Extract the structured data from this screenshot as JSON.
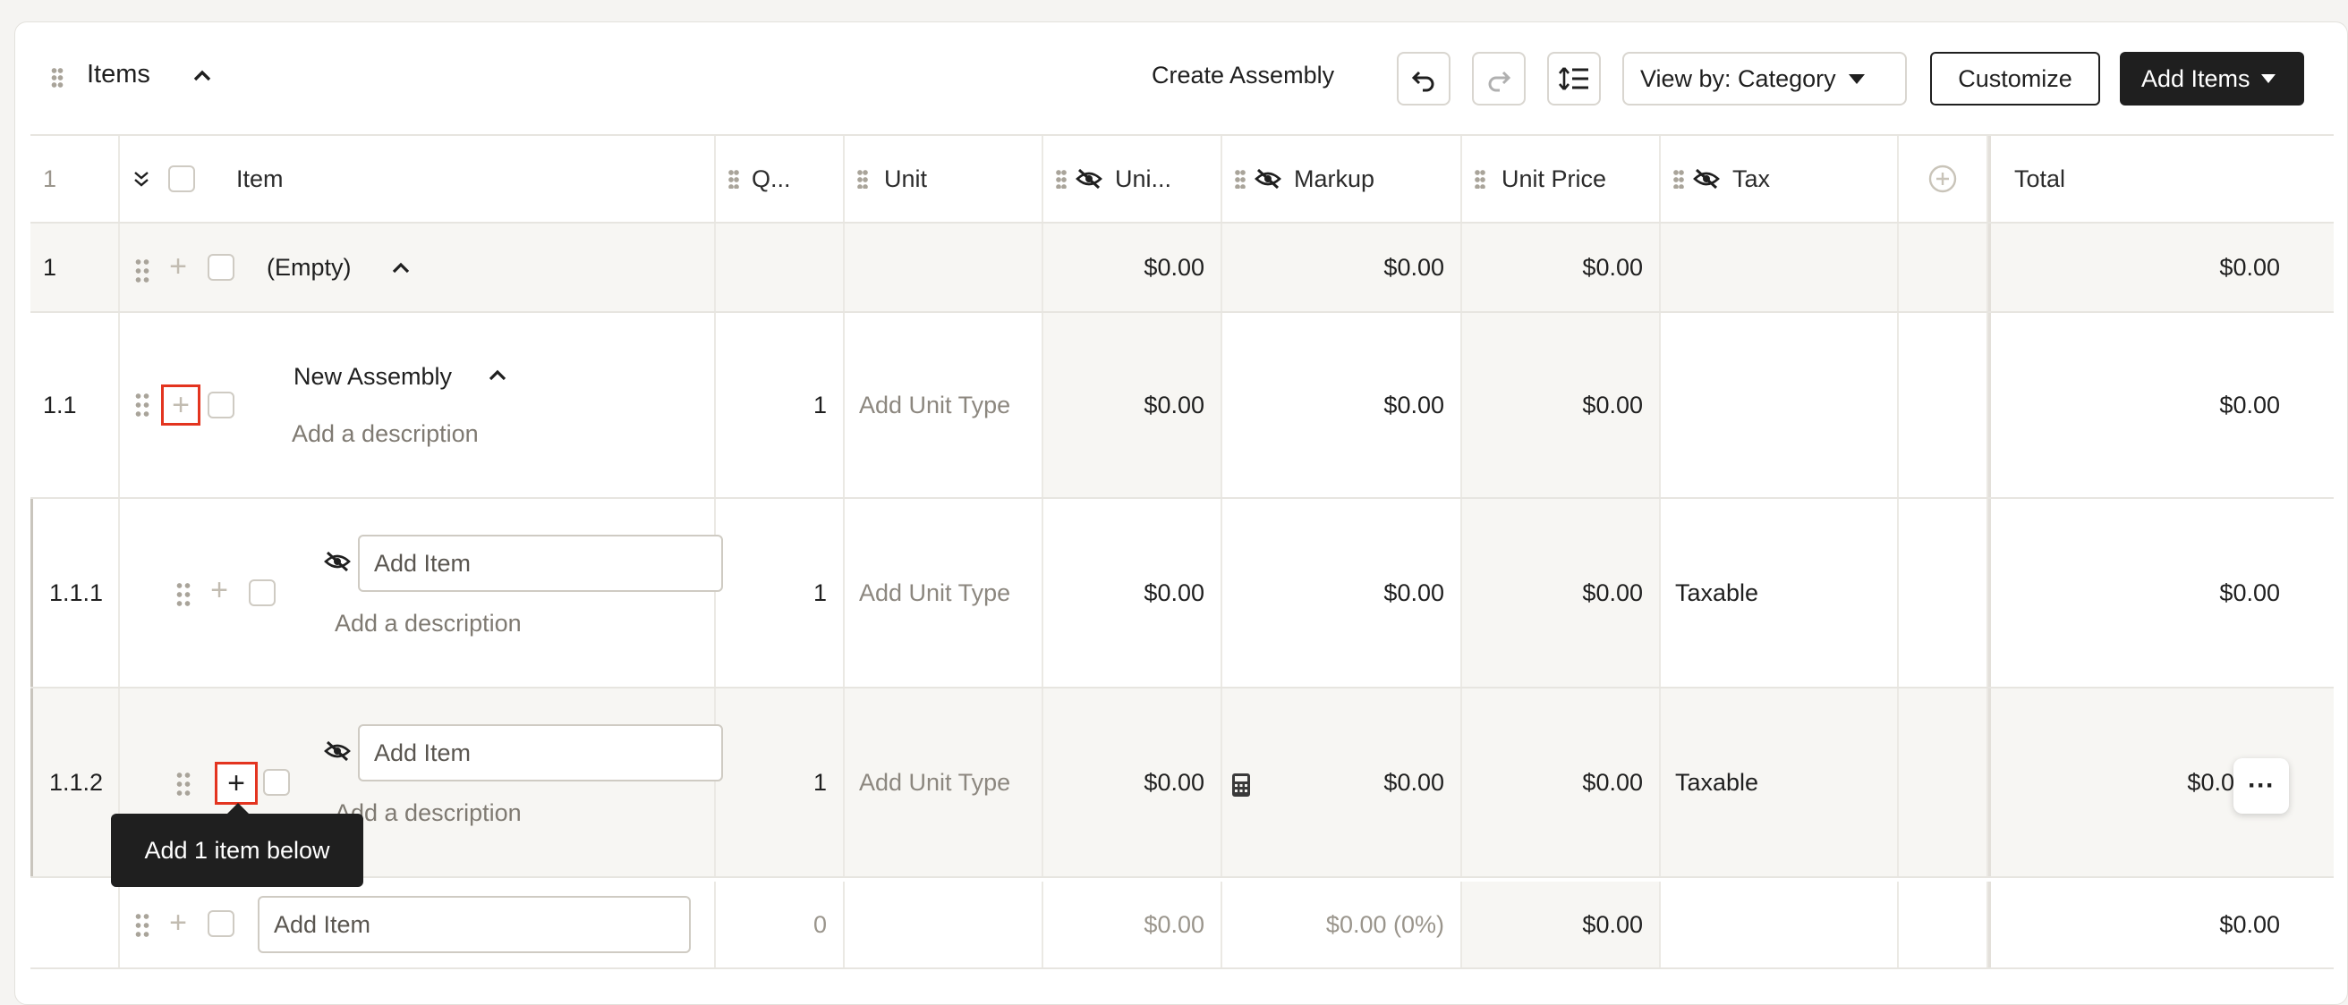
{
  "header": {
    "title": "Items",
    "create_assembly": "Create Assembly",
    "view_by": "View by: Category",
    "customize": "Customize",
    "add_items": "Add Items"
  },
  "columns": {
    "index": "1",
    "item": "Item",
    "qty": "Q...",
    "unit": "Unit",
    "unit_cost": "Uni...",
    "markup": "Markup",
    "unit_price": "Unit Price",
    "tax": "Tax",
    "total": "Total"
  },
  "rows": [
    {
      "idx": "1",
      "name": "(Empty)",
      "qty": "",
      "unit": "",
      "unit_cost": "$0.00",
      "markup": "$0.00",
      "unit_price": "$0.00",
      "tax": "",
      "total": "$0.00"
    },
    {
      "idx": "1.1",
      "name": "New Assembly",
      "desc": "Add a description",
      "qty": "1",
      "unit": "Add Unit Type",
      "unit_cost": "$0.00",
      "markup": "$0.00",
      "unit_price": "$0.00",
      "tax": "",
      "total": "$0.00"
    },
    {
      "idx": "1.1.1",
      "name_placeholder": "Add Item",
      "desc": "Add a description",
      "qty": "1",
      "unit": "Add Unit Type",
      "unit_cost": "$0.00",
      "markup": "$0.00",
      "unit_price": "$0.00",
      "tax": "Taxable",
      "total": "$0.00"
    },
    {
      "idx": "1.1.2",
      "name_placeholder": "Add Item",
      "desc": "Add a description",
      "qty": "1",
      "unit": "Add Unit Type",
      "unit_cost": "$0.00",
      "markup": "$0.00",
      "unit_price": "$0.00",
      "tax": "Taxable",
      "total": "$0.00"
    },
    {
      "idx": "",
      "name_placeholder": "Add Item",
      "qty": "0",
      "unit": "",
      "unit_cost": "$0.00",
      "markup": "$0.00 (0%)",
      "unit_price": "$0.00",
      "tax": "",
      "total": "$0.00"
    }
  ],
  "tooltip": "Add 1 item below",
  "more_label": "···"
}
